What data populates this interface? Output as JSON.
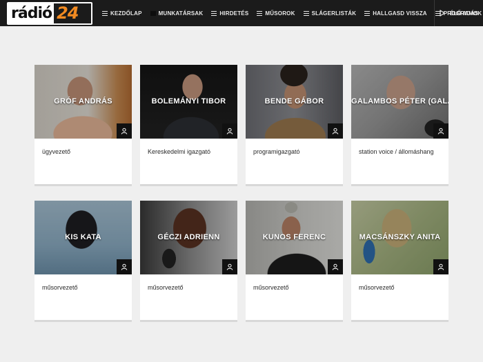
{
  "logo": {
    "part1": "rádió",
    "part2": "24"
  },
  "nav": [
    {
      "label": "KEZDŐLAP",
      "icon": "menu-lines-icon"
    },
    {
      "label": "MUNKATÁRSAK",
      "icon": "square-icon"
    },
    {
      "label": "HIRDETÉS",
      "icon": "menu-lines-icon"
    },
    {
      "label": "MŰSOROK",
      "icon": "menu-lines-icon"
    },
    {
      "label": "SLÁGERLISTÁK",
      "icon": "menu-lines-icon"
    },
    {
      "label": "HALLGASD VISSZA",
      "icon": "menu-lines-icon"
    },
    {
      "label": "PROGRAMOK",
      "icon": "menu-lines-icon"
    }
  ],
  "live": {
    "label": "ÉLŐ ADÁS",
    "icon": "play-icon"
  },
  "staff": [
    {
      "name": "GRÓF ANDRÁS",
      "role": "ügyvezető"
    },
    {
      "name": "BOLEMÁNYI TIBOR",
      "role": "Kereskedelmi igazgató"
    },
    {
      "name": "BENDE GÁBOR",
      "role": "programigazgató"
    },
    {
      "name": "GALAMBOS PÉTER (GALAMB)",
      "role": "station voice / állomáshang"
    },
    {
      "name": "KIS KATA",
      "role": "műsorvezető"
    },
    {
      "name": "GÉCZI ADRIENN",
      "role": "műsorvezető"
    },
    {
      "name": "KUNOS FERENC",
      "role": "műsorvezető"
    },
    {
      "name": "MACSÁNSZKY ANITA",
      "role": "műsorvezető"
    }
  ],
  "colors": {
    "topbar": "#1b1b1b",
    "accent": "#f18a21",
    "page_bg": "#efefef",
    "card": "#ffffff"
  }
}
